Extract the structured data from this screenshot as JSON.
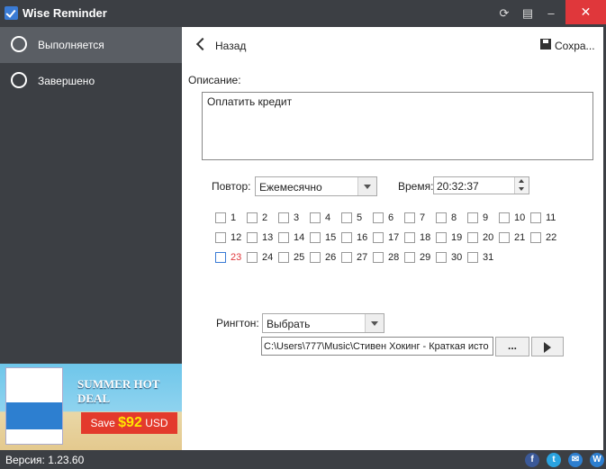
{
  "app": {
    "title": "Wise Reminder"
  },
  "sidebar": {
    "items": [
      {
        "label": "Выполняется"
      },
      {
        "label": "Завершено"
      }
    ]
  },
  "ad": {
    "headline": "SUMMER HOT DEAL",
    "save_prefix": "Save",
    "amount": "$92",
    "currency": "USD"
  },
  "header": {
    "back_label": "Назад",
    "save_label": "Сохра..."
  },
  "form": {
    "description_label": "Описание:",
    "description_value": "Оплатить кредит",
    "repeat_label": "Повтор:",
    "repeat_value": "Ежемесячно",
    "time_label": "Время:",
    "time_value": "20:32:37",
    "days": [
      "1",
      "2",
      "3",
      "4",
      "5",
      "6",
      "7",
      "8",
      "9",
      "10",
      "11",
      "12",
      "13",
      "14",
      "15",
      "16",
      "17",
      "18",
      "19",
      "20",
      "21",
      "22",
      "23",
      "24",
      "25",
      "26",
      "27",
      "28",
      "29",
      "30",
      "31"
    ],
    "highlight_day": "23",
    "ringtone_label": "Рингтон:",
    "ringtone_select": "Выбрать",
    "ringtone_path": "C:\\Users\\777\\Music\\Стивен Хокинг - Краткая исто",
    "browse_label": "..."
  },
  "status": {
    "version": "Версия: 1.23.60"
  },
  "social": [
    {
      "icon": "facebook-icon",
      "glyph": "f",
      "color": "#3b5998"
    },
    {
      "icon": "twitter-icon",
      "glyph": "t",
      "color": "#2aa3e0"
    },
    {
      "icon": "mail-icon",
      "glyph": "✉",
      "color": "#2d7fd0"
    },
    {
      "icon": "wise-icon",
      "glyph": "W",
      "color": "#2d7fd0"
    }
  ],
  "colors": {
    "accent": "#3a7bd5",
    "close": "#e0373b",
    "sidebar": "#3c3f44",
    "highlight_day": "#e0373b"
  }
}
